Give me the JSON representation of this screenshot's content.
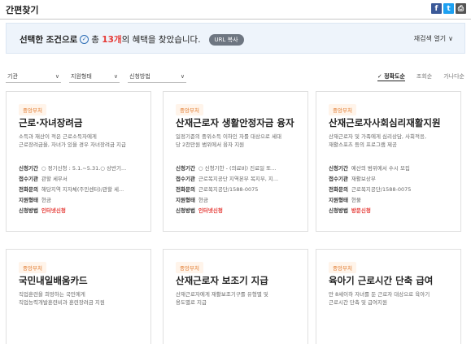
{
  "header": {
    "title": "간편찾기"
  },
  "share": {
    "facebook": "f",
    "twitter": "t",
    "print": "⎙"
  },
  "banner": {
    "prefix": "선택한 조건으로",
    "total": "총",
    "count": "13개",
    "suffix": "의 혜택을 찾았습니다.",
    "url_copy": "URL 복사",
    "reset": "재검색 열기"
  },
  "filters": [
    {
      "label": "기관"
    },
    {
      "label": "지원형태"
    },
    {
      "label": "신청방법"
    }
  ],
  "sort": [
    {
      "label": "✓ 정확도순"
    },
    {
      "label": "조회순"
    },
    {
      "label": "가나다순"
    }
  ],
  "cards": [
    {
      "badge": "중앙부처",
      "title": "근로·자녀장려금",
      "desc": [
        "소득과 재산이 적은 근로소득자에게",
        "근로장려금을, 자녀가 있을 경우 자녀장려금 지급"
      ],
      "details": [
        {
          "label": "신청기간",
          "value": "○ 정기신청 : 5.1.~5.31.○ 상반기..."
        },
        {
          "label": "접수기관",
          "value": "관할 세무서"
        },
        {
          "label": "전화문의",
          "value": "해당지역 지자체(주민센터)/관할 세..."
        },
        {
          "label": "지원형태",
          "value": "현금"
        },
        {
          "label": "신청방법",
          "value": "인터넷신청"
        }
      ]
    },
    {
      "badge": "중앙부처",
      "title": "산재근로자 생활안정자금 융자",
      "desc": [
        "일정기준의 중위소득 이하인 자를 대상으로 세대",
        "당 2천만원 범위에서 융자 지원"
      ],
      "details": [
        {
          "label": "신청기간",
          "value": "○ 신청기한 - (의료비) 진료일 또..."
        },
        {
          "label": "접수기관",
          "value": "근로복지공단 지역본부 복지부, 지..."
        },
        {
          "label": "전화문의",
          "value": "근로복지공단/1588-0075"
        },
        {
          "label": "지원형태",
          "value": "현금"
        },
        {
          "label": "신청방법",
          "value": "인터넷신청"
        }
      ]
    },
    {
      "badge": "중앙부처",
      "title": "산재근로자사회심리재활지원",
      "desc": [
        "산재근로자 및 가족에게 심리상담, 사회적응,",
        "재활스포츠 등의 프로그램 제공"
      ],
      "details": [
        {
          "label": "신청기간",
          "value": "예산의 범위에서 수시 모집"
        },
        {
          "label": "접수기관",
          "value": "재활보상부"
        },
        {
          "label": "전화문의",
          "value": "근로복지공단/1588-0075"
        },
        {
          "label": "지원형태",
          "value": "현물"
        },
        {
          "label": "신청방법",
          "value": "방문신청"
        }
      ]
    },
    {
      "badge": "중앙부처",
      "title": "국민내일배움카드",
      "desc": [
        "직업훈련을 희망하는 국민에게",
        "직업능력개발훈련비과 훈련장려금 지원"
      ],
      "details": []
    },
    {
      "badge": "중앙부처",
      "title": "산재근로자 보조기 지급",
      "desc": [
        "산재근로자에게 재활보조기구를 유형별 및",
        "용도별로 지급"
      ],
      "details": []
    },
    {
      "badge": "중앙부처",
      "title": "육아기 근로시간 단축 급여",
      "desc": [
        "만 8세이하 자녀를 둔 근로자 대상으로 육아기",
        "근로시간 단축 및 급여지원"
      ],
      "details": []
    }
  ]
}
